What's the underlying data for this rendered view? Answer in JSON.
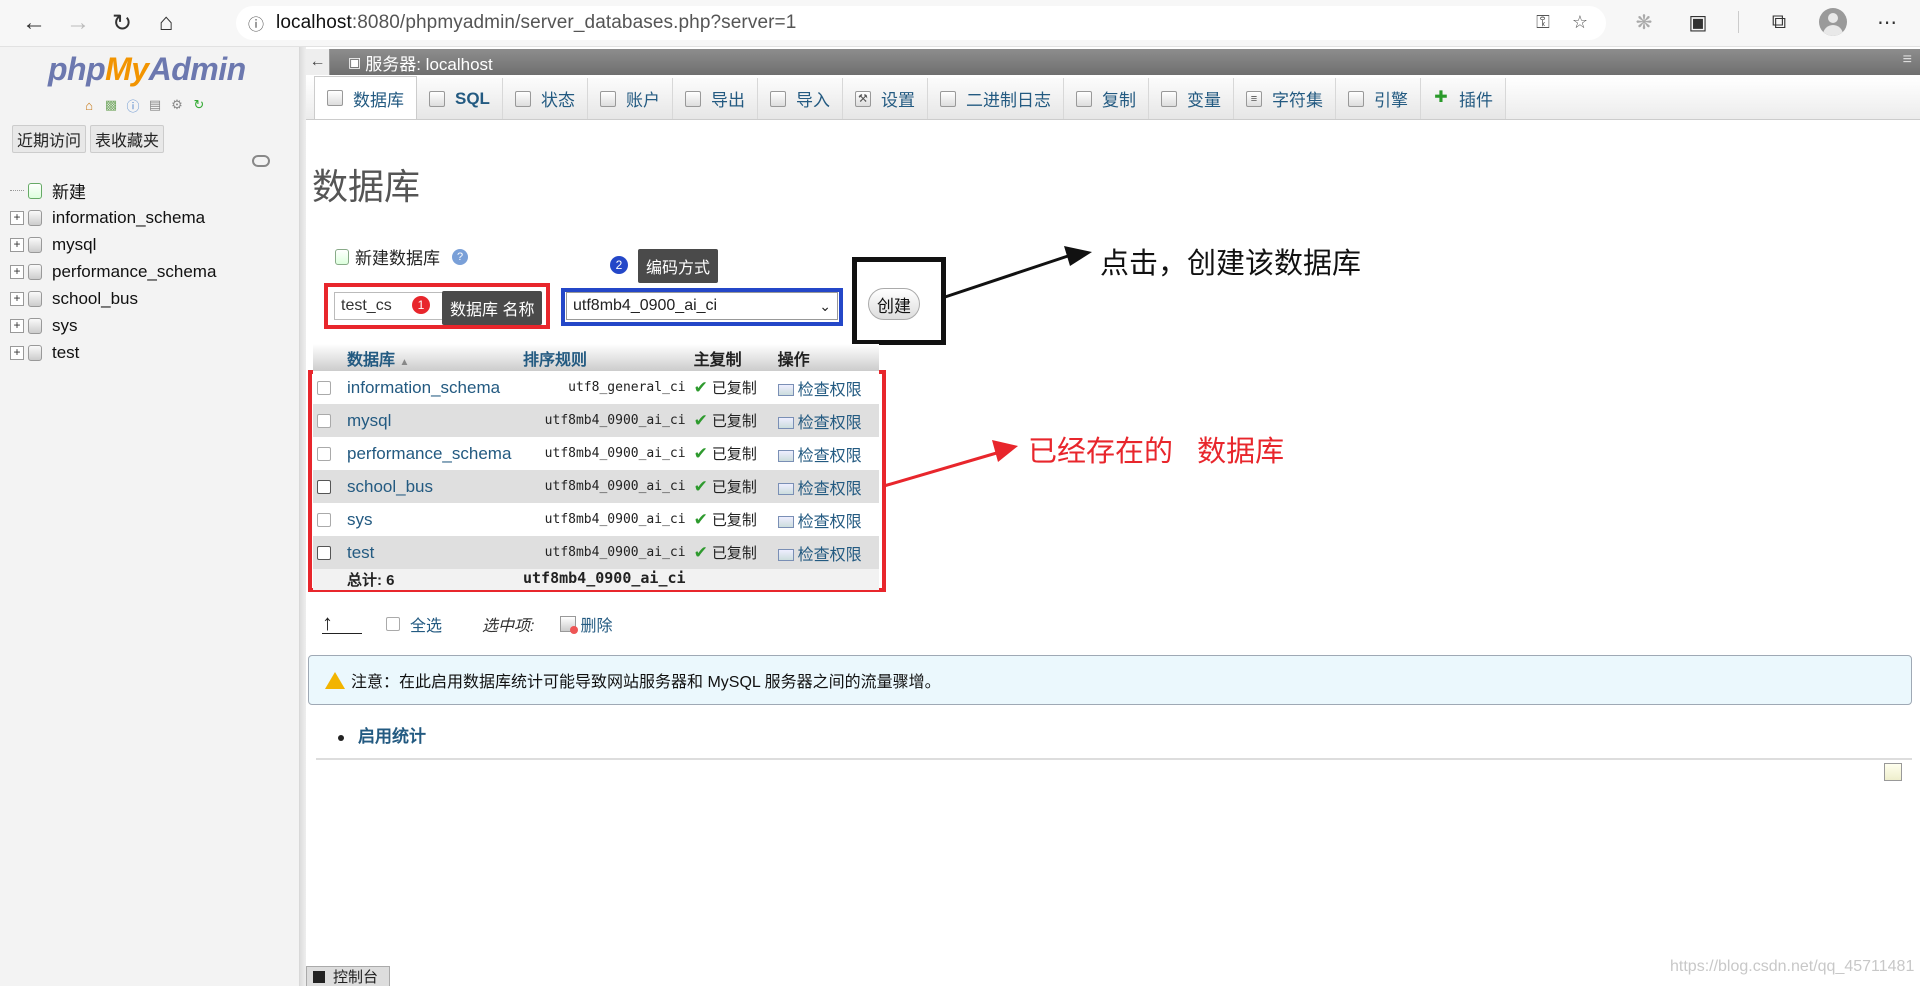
{
  "browser": {
    "url_host": "localhost",
    "url_rest": ":8080/phpmyadmin/server_databases.php?server=1"
  },
  "nav": {
    "logo": {
      "php": "php",
      "my": "My",
      "admin": "Admin"
    },
    "links": [
      "近期访问",
      "表收藏夹"
    ],
    "tree": [
      {
        "label": "新建",
        "type": "new"
      },
      {
        "label": "information_schema",
        "type": "db"
      },
      {
        "label": "mysql",
        "type": "db"
      },
      {
        "label": "performance_schema",
        "type": "db"
      },
      {
        "label": "school_bus",
        "type": "db"
      },
      {
        "label": "sys",
        "type": "db"
      },
      {
        "label": "test",
        "type": "db"
      }
    ]
  },
  "server_label": "服务器: localhost",
  "tabs": [
    "数据库",
    "SQL",
    "状态",
    "账户",
    "导出",
    "导入",
    "设置",
    "二进制日志",
    "复制",
    "变量",
    "字符集",
    "引擎",
    "插件"
  ],
  "page_title": "数据库",
  "create_form": {
    "label": "新建数据库",
    "name_value": "test_cs",
    "collation_value": "utf8mb4_0900_ai_ci",
    "create_button": "创建",
    "badge1": "1",
    "badge2": "2",
    "tooltip_name": "数据库  名称",
    "tooltip_collation": "编码方式"
  },
  "annotations": {
    "click_create": "点击，创建该数据库",
    "existing_dbs": "已经存在的   数据库"
  },
  "table": {
    "headers": {
      "database": "数据库",
      "collation": "排序规则",
      "replication": "主复制",
      "action": "操作"
    },
    "rows": [
      {
        "name": "information_schema",
        "collation": "utf8_general_ci",
        "replication": "已复制",
        "action": "检查权限"
      },
      {
        "name": "mysql",
        "collation": "utf8mb4_0900_ai_ci",
        "replication": "已复制",
        "action": "检查权限"
      },
      {
        "name": "performance_schema",
        "collation": "utf8mb4_0900_ai_ci",
        "replication": "已复制",
        "action": "检查权限"
      },
      {
        "name": "school_bus",
        "collation": "utf8mb4_0900_ai_ci",
        "replication": "已复制",
        "action": "检查权限"
      },
      {
        "name": "sys",
        "collation": "utf8mb4_0900_ai_ci",
        "replication": "已复制",
        "action": "检查权限"
      },
      {
        "name": "test",
        "collation": "utf8mb4_0900_ai_ci",
        "replication": "已复制",
        "action": "检查权限"
      }
    ],
    "total_label": "总计: 6",
    "total_collation": "utf8mb4_0900_ai_ci"
  },
  "bulk": {
    "select_all": "全选",
    "with_selected": "选中项:",
    "delete": "删除"
  },
  "notice": "注意：在此启用数据库统计可能导致网站服务器和 MySQL 服务器之间的流量骤增。",
  "enable_stats": "启用统计",
  "console": "控制台",
  "watermark": "https://blog.csdn.net/qq_45711481",
  "colors": {
    "accent_red": "#e8262c",
    "accent_blue": "#2447c8",
    "link": "#235a81"
  }
}
